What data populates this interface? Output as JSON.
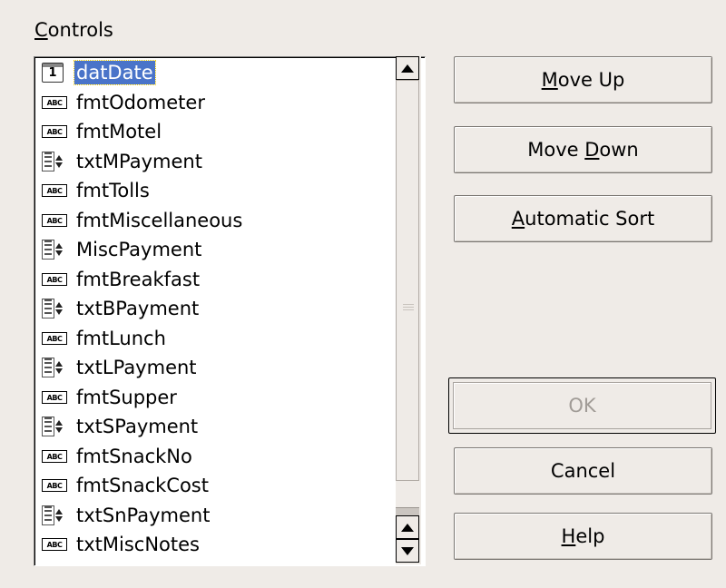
{
  "dialog": {
    "controls_label": {
      "accel": "C",
      "rest": "ontrols"
    }
  },
  "list": {
    "items": [
      {
        "label": "datDate",
        "icon": "date-field-icon",
        "selected": true
      },
      {
        "label": "fmtOdometer",
        "icon": "formatted-field-icon"
      },
      {
        "label": "fmtMotel",
        "icon": "formatted-field-icon"
      },
      {
        "label": "txtMPayment",
        "icon": "numeric-field-icon"
      },
      {
        "label": "fmtTolls",
        "icon": "formatted-field-icon"
      },
      {
        "label": "fmtMiscellaneous",
        "icon": "formatted-field-icon"
      },
      {
        "label": "MiscPayment",
        "icon": "numeric-field-icon"
      },
      {
        "label": "fmtBreakfast",
        "icon": "formatted-field-icon"
      },
      {
        "label": "txtBPayment",
        "icon": "numeric-field-icon"
      },
      {
        "label": "fmtLunch",
        "icon": "formatted-field-icon"
      },
      {
        "label": "txtLPayment",
        "icon": "numeric-field-icon"
      },
      {
        "label": "fmtSupper",
        "icon": "formatted-field-icon"
      },
      {
        "label": "txtSPayment",
        "icon": "numeric-field-icon"
      },
      {
        "label": "fmtSnackNo",
        "icon": "formatted-field-icon"
      },
      {
        "label": "fmtSnackCost",
        "icon": "formatted-field-icon"
      },
      {
        "label": "txtSnPayment",
        "icon": "numeric-field-icon"
      },
      {
        "label": "txtMiscNotes",
        "icon": "formatted-field-icon"
      }
    ],
    "icon_text": {
      "formatted": "ABC",
      "date": "1"
    },
    "selection_color": "#4a74c9"
  },
  "buttons": {
    "move_up": {
      "accel": "M",
      "rest": "ove Up"
    },
    "move_down": {
      "pre": "Move ",
      "accel": "D",
      "rest": "own"
    },
    "automatic_sort": {
      "accel": "A",
      "rest": "utomatic Sort"
    },
    "ok": {
      "label": "OK",
      "disabled": true
    },
    "cancel": {
      "label": "Cancel"
    },
    "help": {
      "accel": "H",
      "rest": "elp"
    }
  }
}
